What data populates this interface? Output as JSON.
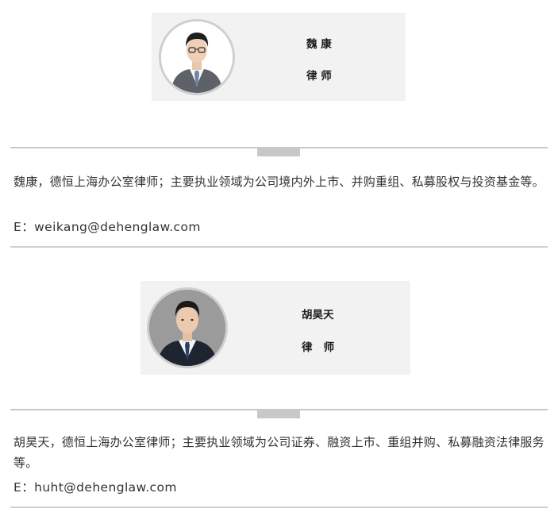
{
  "profiles": [
    {
      "name": "魏 康",
      "title": "律 师",
      "bio": "魏康，德恒上海办公室律师；主要执业领域为公司境内外上市、并购重组、私募股权与投资基金等。",
      "email": "E：weikang@dehenglaw.com"
    },
    {
      "name": "胡昊天",
      "title": "律   师",
      "bio": "胡昊天，德恒上海办公室律师；主要执业领域为公司证券、融资上市、重组并购、私募融资法律服务等。",
      "email": "E：huht@dehenglaw.com"
    }
  ],
  "colors": {
    "card_background": "#f2f2f2",
    "divider": "#c8c8c8",
    "text": "#333333"
  }
}
